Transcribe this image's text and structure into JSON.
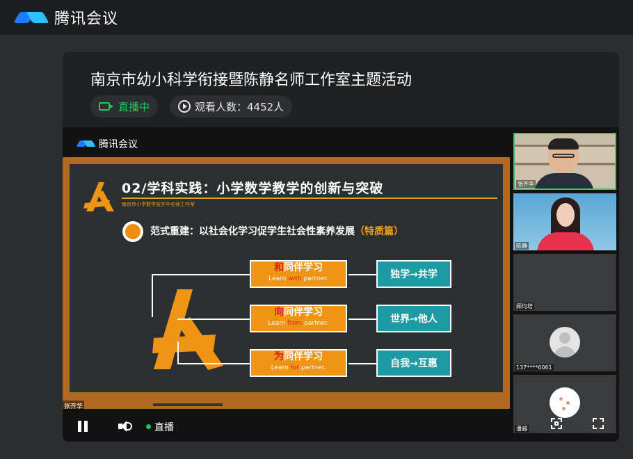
{
  "app": {
    "name": "腾讯会议"
  },
  "header": {
    "title": "南京市幼小科学衔接暨陈静名师工作室主题活动",
    "live_label": "直播中",
    "viewers_label": "观看人数：4452人"
  },
  "video": {
    "brand": "腾讯会议",
    "speaker_tag": "张齐华",
    "slide": {
      "title": "02/学科实践：小学数学教学的创新与突破",
      "subtitle": "南京市小学数学张齐华名师工作室",
      "section": "范式重建：以社会化学习促学生社会性素养发展",
      "section_tag": "（特质篇）",
      "rows": [
        {
          "cn_prefix": "和",
          "cn_rest": "同伴学习",
          "en_a": "Learn ",
          "en_key": "with",
          "en_b": " partner.",
          "result": "独学→共学"
        },
        {
          "cn_prefix": "向",
          "cn_rest": "同伴学习",
          "en_a": "Learn ",
          "en_key": "from",
          "en_b": " partner.",
          "result": "世界→他人"
        },
        {
          "cn_prefix": "为",
          "cn_rest": "同伴学习",
          "en_a": "Learn ",
          "en_key": "for",
          "en_b": " partner.",
          "result": "自我→互惠"
        }
      ]
    },
    "controls": {
      "live_text": "直播"
    }
  },
  "participants": [
    {
      "name": "张齐华"
    },
    {
      "name": "陈静"
    },
    {
      "name": "顾均培"
    },
    {
      "name": "137****6061"
    },
    {
      "name": "潘越"
    }
  ],
  "colors": {
    "accent_green": "#22c55e",
    "board_orange": "#f09415",
    "teal": "#1e9aa5"
  }
}
